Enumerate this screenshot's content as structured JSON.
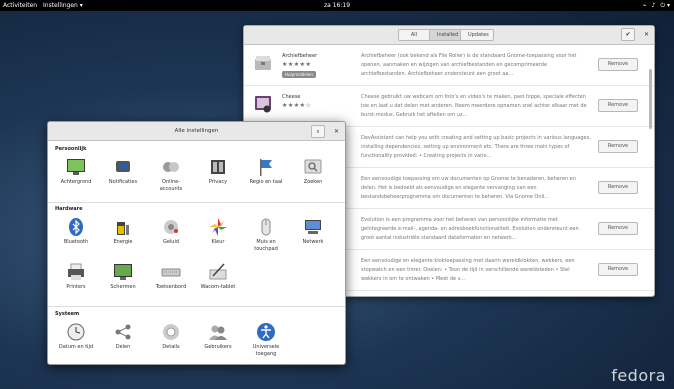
{
  "topbar": {
    "activities": "Activiteiten",
    "app_menu": "Instellingen ▾",
    "clock": "za 16:19",
    "indicators": [
      "⌁",
      "♪",
      "⏻ ▾"
    ]
  },
  "watermark": "fedora",
  "software": {
    "tabs": [
      "All",
      "Installed",
      "Updates"
    ],
    "active_tab": "Installed",
    "confirm": "✔",
    "close": "✕",
    "apps": [
      {
        "name": "Archiefbeheer",
        "stars": "★★★★★",
        "badge": "Hulpmiddelen",
        "icon": "file-roller-icon",
        "desc": "Archiefbeheer (ook bekend als File Roller) is de standaard Gnome-toepassing voor het openen, aanmaken en wijzigen van archiefbestanden en gecomprimeerde archiefbestanden. Archiefbeheer ondersteunt een groot aa...",
        "button": "Remove"
      },
      {
        "name": "Cheese",
        "stars": "★★★★☆",
        "badge": "",
        "icon": "cheese-icon",
        "desc": "Cheese gebruikt uw webcam om foto's en video's te maken, past hippe, speciale effecten toe en laat u dat delen met anderen. Neem meerdere opnamen snel achter elkaar met de burst-modus. Gebruik het aftellen om uz...",
        "button": "Remove"
      },
      {
        "name": "",
        "stars": "",
        "badge": "",
        "icon": "",
        "desc": "DevAssistant can help you with creating and setting up basic projects in various languages, installing dependencies, setting up environment etc. There are three main types of functionality provided: • Creating projects in vario...",
        "button": "Remove"
      },
      {
        "name": "",
        "stars": "",
        "badge": "",
        "icon": "",
        "desc": "Een eenvoudige toepassing om uw documenten op Gnome te benaderen, beheren en delen. Het is bedoeld als eenvoudige en elegante vervanging van een bestandsbeheerprogramma om documenten te beheren. Via Gnome Onli...",
        "button": "Remove"
      },
      {
        "name": "",
        "stars": "",
        "badge": "",
        "icon": "",
        "desc": "Evolution is een programma voor het beheren van persoonlijke informatie met geïntegreerde e-mail-, agenda- en adresboekfunctionaliteit. Evolution ondersteunt een groot aantal industriële standaard dataformaten en netwerk...",
        "button": "Remove"
      },
      {
        "name": "",
        "stars": "",
        "badge": "",
        "icon": "",
        "desc": "Een eenvoudige en elegante kloktoepassing met daarin wereldklokken, wekkers, een stopwatch en een timer. Doelen: • Toon de tijd in verschillende wereldsteden • Stel wekkers in om te ontwaken • Meet de v...",
        "button": "Remove"
      }
    ]
  },
  "settings": {
    "title": "Alle instellingen",
    "search_icon": "⌕",
    "close": "✕",
    "sections": [
      {
        "title": "Persoonlijk",
        "items": [
          {
            "label": "Achtergrond",
            "icon": "background-icon"
          },
          {
            "label": "Notificaties",
            "icon": "notifications-icon"
          },
          {
            "label": "Online-\naccounts",
            "icon": "online-accounts-icon"
          },
          {
            "label": "Privacy",
            "icon": "privacy-icon"
          },
          {
            "label": "Regio en taal",
            "icon": "region-flag-icon"
          },
          {
            "label": "Zoeken",
            "icon": "search-settings-icon"
          }
        ]
      },
      {
        "title": "Hardware",
        "items": [
          {
            "label": "Bluetooth",
            "icon": "bluetooth-icon"
          },
          {
            "label": "Energie",
            "icon": "power-icon"
          },
          {
            "label": "Geluid",
            "icon": "sound-icon"
          },
          {
            "label": "Kleur",
            "icon": "color-icon"
          },
          {
            "label": "Muis en\ntouchpad",
            "icon": "mouse-icon"
          },
          {
            "label": "Netwerk",
            "icon": "network-icon"
          },
          {
            "label": "Printers",
            "icon": "printer-icon"
          },
          {
            "label": "Schermen",
            "icon": "displays-icon"
          },
          {
            "label": "Toetsenbord",
            "icon": "keyboard-icon"
          },
          {
            "label": "Wacom-tablet",
            "icon": "wacom-icon"
          }
        ]
      },
      {
        "title": "Systeem",
        "items": [
          {
            "label": "Datum en tijd",
            "icon": "clock-icon"
          },
          {
            "label": "Delen",
            "icon": "share-icon"
          },
          {
            "label": "Details",
            "icon": "details-icon"
          },
          {
            "label": "Gebruikers",
            "icon": "users-icon"
          },
          {
            "label": "Universele\ntoegang",
            "icon": "accessibility-icon"
          }
        ]
      }
    ]
  }
}
